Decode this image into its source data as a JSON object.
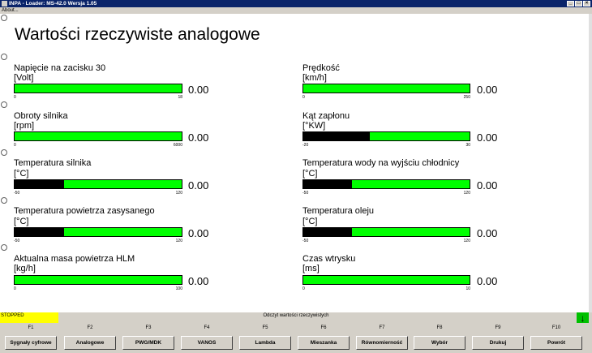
{
  "window": {
    "title": "INPA - Loader: MS-42.0 Wersja 1.05"
  },
  "menu": {
    "about": "About..."
  },
  "page": {
    "title": "Wartości rzeczywiste analogowe"
  },
  "gauges": [
    {
      "label": "Napięcie na zacisku 30",
      "unit": "[Volt]",
      "value_text": "0.00",
      "min": "0",
      "max": "18",
      "fill_fraction": 0
    },
    {
      "label": "Prędkość",
      "unit": "[km/h]",
      "value_text": "0.00",
      "min": "0",
      "max": "250",
      "fill_fraction": 0
    },
    {
      "label": "Obroty silnika",
      "unit": "[rpm]",
      "value_text": "0.00",
      "min": "0",
      "max": "6000",
      "fill_fraction": 0
    },
    {
      "label": "Kąt zapłonu",
      "unit": "[°KW]",
      "value_text": "0.00",
      "min": "-20",
      "max": "30",
      "fill_fraction": 0.4
    },
    {
      "label": "Temperatura silnika",
      "unit": "[°C]",
      "value_text": "0.00",
      "min": "-50",
      "max": "120",
      "fill_fraction": 0.294
    },
    {
      "label": "Temperatura wody na wyjściu chłodnicy",
      "unit": "[°C]",
      "value_text": "0.00",
      "min": "-50",
      "max": "120",
      "fill_fraction": 0.294
    },
    {
      "label": "Temperatura powietrza zasysanego",
      "unit": "[°C]",
      "value_text": "0.00",
      "min": "-50",
      "max": "120",
      "fill_fraction": 0.294
    },
    {
      "label": "Temperatura oleju",
      "unit": "[°C]",
      "value_text": "0.00",
      "min": "-50",
      "max": "120",
      "fill_fraction": 0.294
    },
    {
      "label": "Aktualna masa powietrza HLM",
      "unit": "[kg/h]",
      "value_text": "0.00",
      "min": "0",
      "max": "100",
      "fill_fraction": 0
    },
    {
      "label": "Czas wtrysku",
      "unit": "[ms]",
      "value_text": "0.00",
      "min": "0",
      "max": "10",
      "fill_fraction": 0
    }
  ],
  "status": {
    "state": "STOPPED",
    "message": "Odczyt wartości rzeczywistych"
  },
  "fkeys": [
    {
      "key": "F1",
      "label": "Sygnały cyfrowe"
    },
    {
      "key": "F2",
      "label": "Analogowe"
    },
    {
      "key": "F3",
      "label": "PWG/MDK"
    },
    {
      "key": "F4",
      "label": "VANOS"
    },
    {
      "key": "F5",
      "label": "Lambda"
    },
    {
      "key": "F6",
      "label": "Mieszanka"
    },
    {
      "key": "F7",
      "label": "Równomierność"
    },
    {
      "key": "F8",
      "label": "Wybór"
    },
    {
      "key": "F9",
      "label": "Drukuj"
    },
    {
      "key": "F10",
      "label": "Powrót"
    }
  ],
  "colors": {
    "bar_green": "#00ff00",
    "bar_fill": "#000000",
    "status_yellow": "#ffff00",
    "arrow_green": "#00c000"
  }
}
